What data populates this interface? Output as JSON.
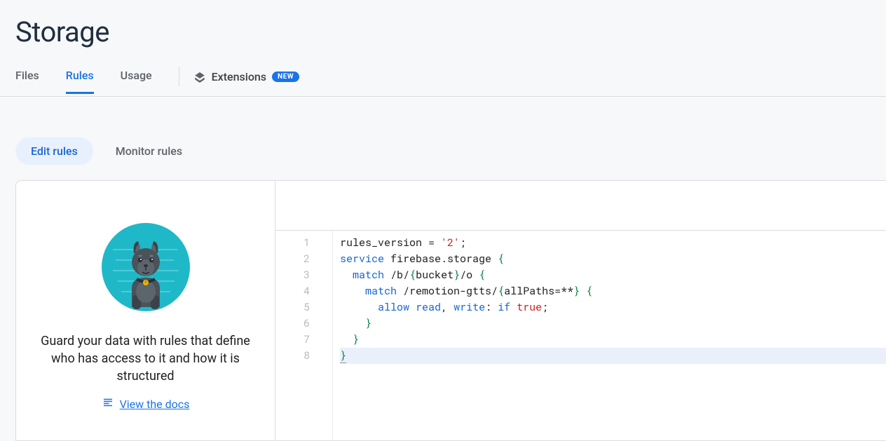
{
  "header": {
    "title": "Storage"
  },
  "tabs": {
    "files": "Files",
    "rules": "Rules",
    "usage": "Usage",
    "extensions": "Extensions",
    "ext_badge": "NEW"
  },
  "subtabs": {
    "edit": "Edit rules",
    "monitor": "Monitor rules"
  },
  "guard": {
    "text": "Guard your data with rules that define who has access to it and how it is structured",
    "docs_link": "View the docs"
  },
  "editor": {
    "gutter": [
      "1",
      "2",
      "3",
      "4",
      "5",
      "6",
      "7",
      "8"
    ],
    "lines": {
      "l1_a": "rules_version = ",
      "l1_str": "'2'",
      "l1_b": ";",
      "l2_kw": "service",
      "l2_a": " firebase.storage ",
      "l2_brace": "{",
      "l3_pad": "  ",
      "l3_kw": "match",
      "l3_a": " /b/",
      "l3_br1": "{",
      "l3_b": "bucket",
      "l3_br2": "}",
      "l3_c": "/o ",
      "l3_brace": "{",
      "l4_pad": "    ",
      "l4_kw": "match",
      "l4_a": " /remotion-gtts/",
      "l4_br1": "{",
      "l4_b": "allPaths=**",
      "l4_br2": "}",
      "l4_c": " ",
      "l4_brace": "{",
      "l5_pad": "      ",
      "l5_kw1": "allow",
      "l5_a": " ",
      "l5_kw2": "read",
      "l5_b": ", ",
      "l5_kw3": "write",
      "l5_c": ": ",
      "l5_kw4": "if",
      "l5_d": " ",
      "l5_true": "true",
      "l5_e": ";",
      "l6": "    }",
      "l7": "  }",
      "l8": "}"
    }
  }
}
